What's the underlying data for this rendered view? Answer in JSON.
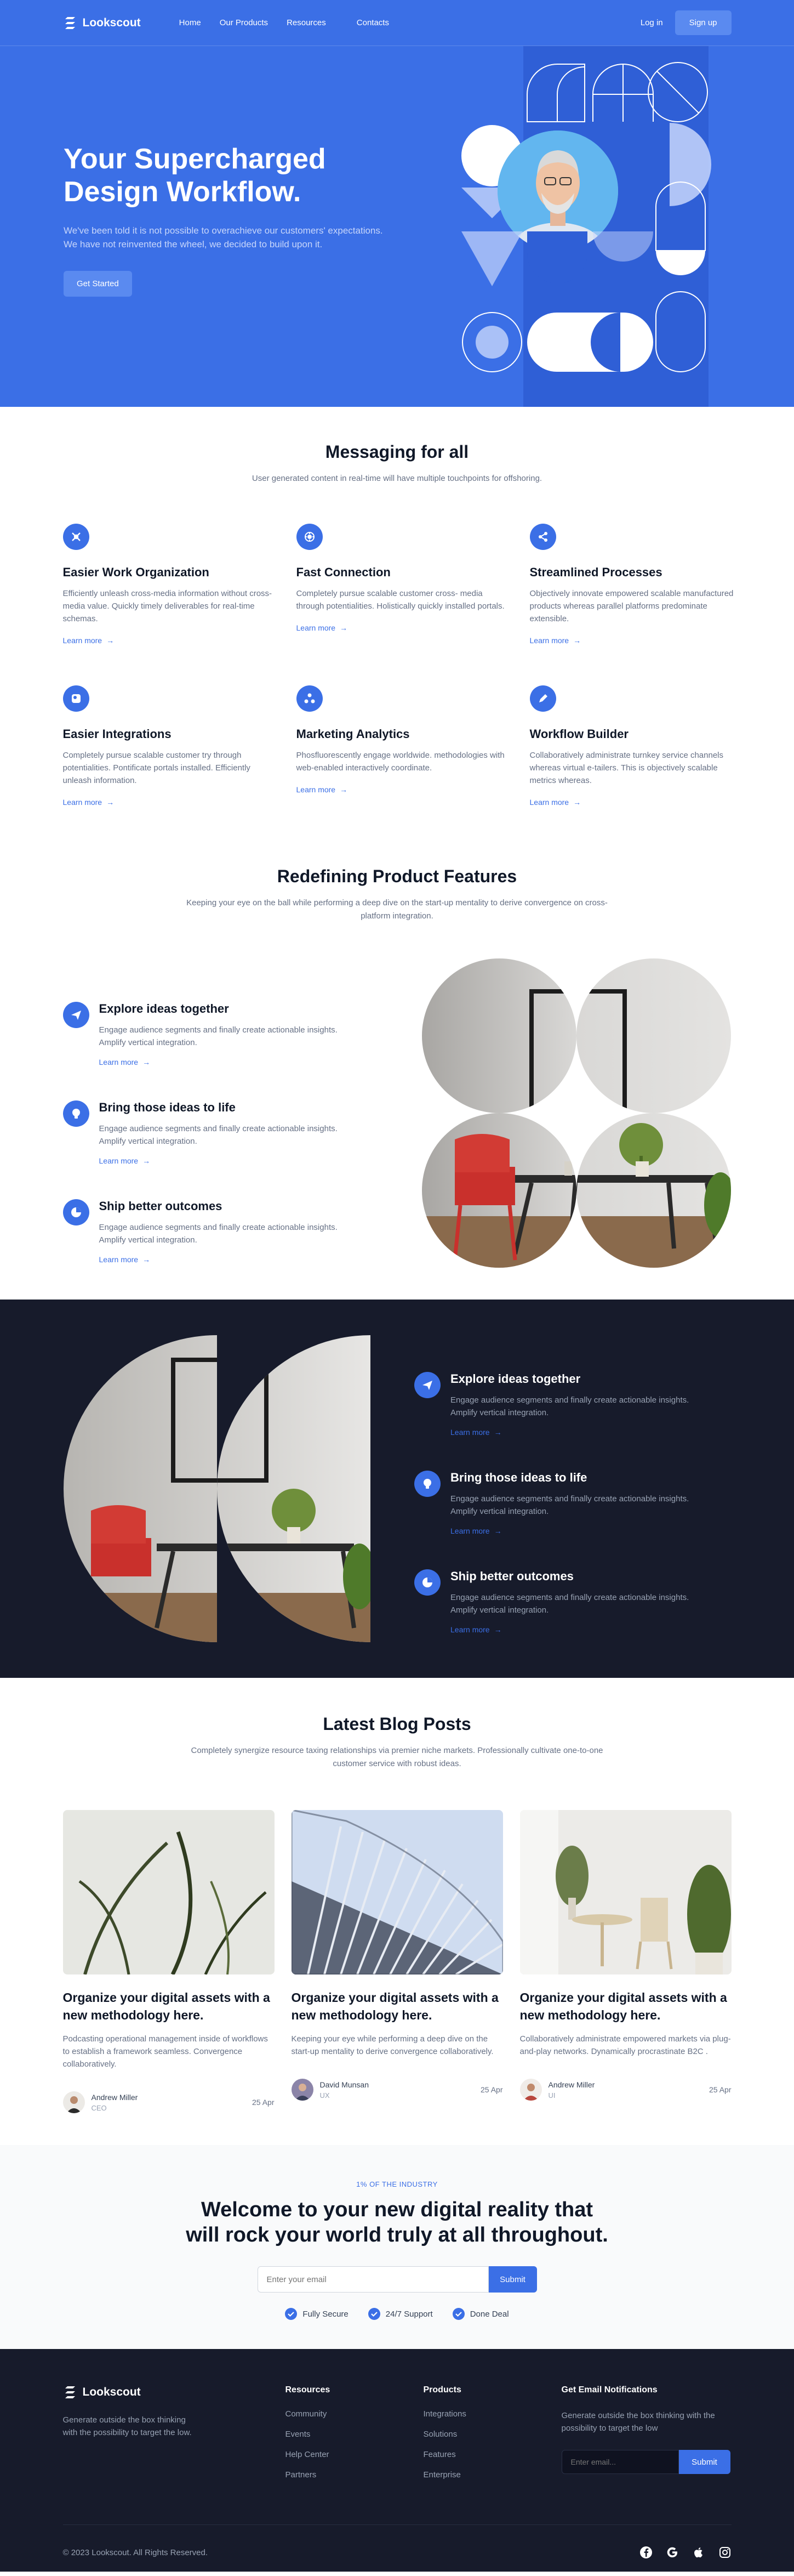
{
  "brand": {
    "name": "Lookscout"
  },
  "nav": {
    "items": [
      "Home",
      "Our Products",
      "Resources",
      "Contacts"
    ],
    "login": "Log in",
    "signup": "Sign up"
  },
  "hero": {
    "title": "Your Supercharged Design Workflow.",
    "text": "We've been told it is not possible to overachieve our customers' expectations. We have not reinvented the wheel, we decided to build upon it.",
    "cta": "Get Started"
  },
  "messaging": {
    "title": "Messaging for all",
    "subtitle": "User generated content in real-time will have multiple touchpoints for offshoring.",
    "learn_more": "Learn more",
    "items": [
      {
        "icon": "cross-arrows-icon",
        "title": "Easier Work Organization",
        "text": "Efficiently unleash cross-media information without cross-media value. Quickly timely deliverables for real-time schemas."
      },
      {
        "icon": "connection-icon",
        "title": "Fast Connection",
        "text": "Completely pursue scalable customer cross- media through potentialities. Holistically quickly installed portals."
      },
      {
        "icon": "share-icon",
        "title": "Streamlined Processes",
        "text": "Objectively innovate empowered scalable manufactured products whereas parallel platforms predominate extensible."
      },
      {
        "icon": "integration-icon",
        "title": "Easier Integrations",
        "text": "Completely pursue scalable customer try through potentialities. Pontificate portals installed. Efficiently unleash information."
      },
      {
        "icon": "analytics-icon",
        "title": "Marketing Analytics",
        "text": "Phosfluorescently engage worldwide. methodologies with web-enabled interactively coordinate."
      },
      {
        "icon": "pen-icon",
        "title": "Workflow Builder",
        "text": "Collaboratively administrate turnkey service channels whereas virtual e-tailers. This is objectively scalable metrics whereas."
      }
    ]
  },
  "product": {
    "title": "Redefining Product Features",
    "subtitle": "Keeping your eye on the ball while performing a deep dive on the start-up mentality to derive convergence on cross-platform integration.",
    "learn_more": "Learn more",
    "items": [
      {
        "icon": "paper-plane-icon",
        "title": "Explore ideas together",
        "text": "Engage audience segments and finally create actionable insights. Amplify vertical integration."
      },
      {
        "icon": "lightbulb-icon",
        "title": "Bring those ideas to life",
        "text": "Engage audience segments and finally create actionable insights. Amplify vertical integration."
      },
      {
        "icon": "pie-chart-icon",
        "title": "Ship better outcomes",
        "text": "Engage audience segments and finally create actionable insights. Amplify vertical integration."
      }
    ]
  },
  "blog": {
    "title": "Latest Blog Posts",
    "subtitle": "Completely synergize resource taxing relationships via premier niche markets. Professionally cultivate one-to-one customer service with robust ideas.",
    "posts": [
      {
        "title": "Organize your digital assets with a new methodology here.",
        "text": "Podcasting operational management inside of workflows to establish a framework seamless. Convergence collaboratively.",
        "author": "Andrew Miller",
        "role": "CEO",
        "date": "25 Apr"
      },
      {
        "title": "Organize your digital assets with a new methodology here.",
        "text": "Keeping your eye while performing a deep dive on the start-up mentality to derive convergence collaboratively.",
        "author": "David Munsan",
        "role": "UX",
        "date": "25 Apr"
      },
      {
        "title": "Organize your digital assets with a new methodology here.",
        "text": "Collaboratively administrate empowered markets via plug-and-play networks. Dynamically procrastinate B2C .",
        "author": "Andrew Miller",
        "role": "UI",
        "date": "25 Apr"
      }
    ]
  },
  "cta": {
    "kicker": "1% OF THE INDUSTRY",
    "title": "Welcome to your new digital reality that will rock your world truly at all throughout.",
    "placeholder": "Enter your email",
    "submit": "Submit",
    "checks": [
      "Fully Secure",
      "24/7 Support",
      "Done Deal"
    ]
  },
  "footer": {
    "desc": "Generate outside the box thinking with the possibility to target the low.",
    "columns": [
      {
        "title": "Resources",
        "links": [
          "Community",
          "Events",
          "Help Center",
          "Partners"
        ]
      },
      {
        "title": "Products",
        "links": [
          "Integrations",
          "Solutions",
          "Features",
          "Enterprise"
        ]
      }
    ],
    "newsletter": {
      "title": "Get Email Notifications",
      "text": "Generate outside the box thinking with the possibility to target the low",
      "placeholder": "Enter email...",
      "submit": "Submit"
    },
    "copyright": "© 2023 Lookscout. All Rights Reserved.",
    "socials": [
      "facebook-icon",
      "google-icon",
      "apple-icon",
      "instagram-icon"
    ]
  },
  "colors": {
    "primary": "#3b6fe6",
    "dark": "#171b2b",
    "muted": "#667085"
  }
}
